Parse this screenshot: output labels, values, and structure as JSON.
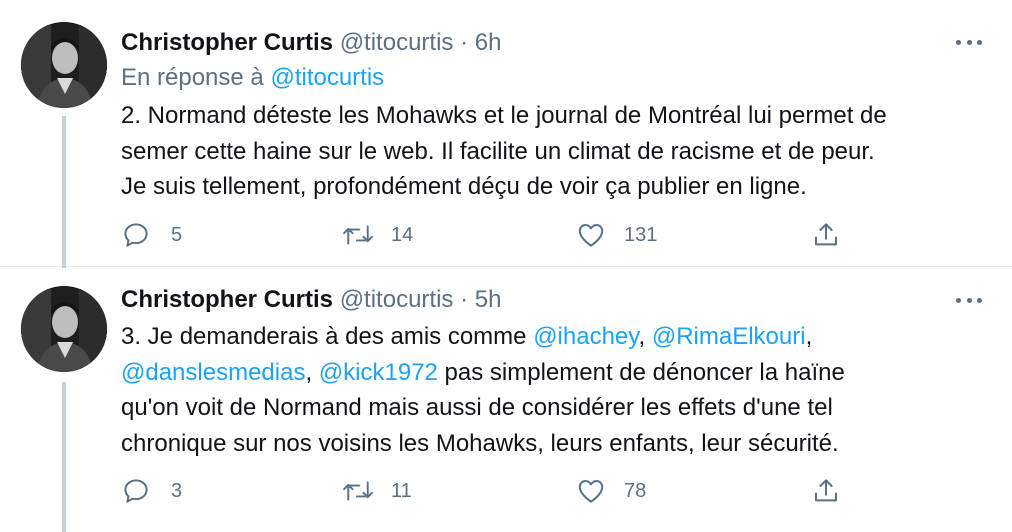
{
  "tweets": [
    {
      "name": "Christopher Curtis",
      "handle": "@titocurtis",
      "separator": "·",
      "time": "6h",
      "reply_prefix": "En réponse à",
      "reply_handle": "@titocurtis",
      "lines": [
        "2. Normand déteste les Mohawks et le journal de Montréal lui permet de",
        "semer cette haine sur le web. Il facilite un climat de racisme et de peur.",
        "Je suis tellement, profondément déçu de voir ça publier en ligne."
      ],
      "replies": "5",
      "retweets": "14",
      "likes": "131"
    },
    {
      "name": "Christopher Curtis",
      "handle": "@titocurtis",
      "separator": "·",
      "time": "5h",
      "line1_text": "3. Je demanderais à des amis comme ",
      "mention1": "@ihachey",
      "comma1": ", ",
      "mention2": "@RimaElkouri",
      "comma2": ",",
      "mention3": "@danslesmedias",
      "comma3": ", ",
      "mention4": "@kick1972",
      "line2_text": " pas simplement de dénoncer la haïne",
      "line3_text": "qu'on voit de Normand mais aussi de considérer les effets d'une tel",
      "line4_text": "chronique sur nos voisins les Mohawks, leurs enfants, leur sécurité.",
      "replies": "3",
      "retweets": "11",
      "likes": "78"
    }
  ],
  "icons": {
    "reply": "reply-icon",
    "retweet": "retweet-icon",
    "like": "heart-icon",
    "share": "share-icon",
    "more": "more-icon"
  },
  "colors": {
    "text": "#0f1419",
    "secondary": "#5b7083",
    "link": "#1da1f2",
    "thread_line": "#c4cfd6"
  }
}
